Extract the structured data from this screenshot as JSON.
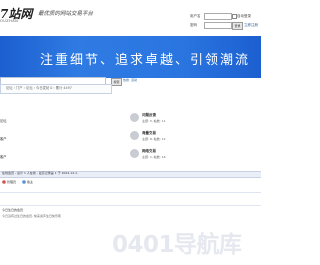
{
  "header": {
    "logo_text": "7站网",
    "logo_sub": "OUZHAN",
    "slogan": "最优质的网站交易平台",
    "login": {
      "username_label": "用户名",
      "password_label": "密码",
      "remember_label": "自动登录",
      "forgot_label": "找回密码",
      "login_button": "登录",
      "register_link": "立即注册"
    }
  },
  "banner": {
    "text": "注重细节、追求卓越、引领潮流"
  },
  "search": {
    "button_label": "搜索",
    "hot_label": "热搜: 活动"
  },
  "breadcrumb": {
    "text": "论坛 › 门户 › 论坛 › 今日发帖 0 › 累计 4497"
  },
  "forums": {
    "left": [
      "论坛",
      "客户",
      "客户"
    ],
    "right": [
      {
        "name": "问题反馈",
        "stats": "主题: 5, 帖数: 11"
      },
      {
        "name": "海量交易",
        "stats": "主题: 8, 帖数: 12"
      },
      {
        "name": "网络交易",
        "stats": "主题: 1, 帖数: 16"
      }
    ]
  },
  "stats": {
    "online_text": "在线会员 - 总计 1 人在线 - 最高记录是 1 于 2024-12-1."
  },
  "legend": {
    "items": [
      "管理员",
      "版主"
    ]
  },
  "birthday": {
    "title": "今日生日的会员",
    "text": "今日没有过生日的会员, 快来说声生日快乐吧"
  },
  "watermark": {
    "text": "0401导航库"
  },
  "colors": {
    "banner": "#2a75e0",
    "link": "#336699",
    "watermark": "#e5e9ef"
  }
}
